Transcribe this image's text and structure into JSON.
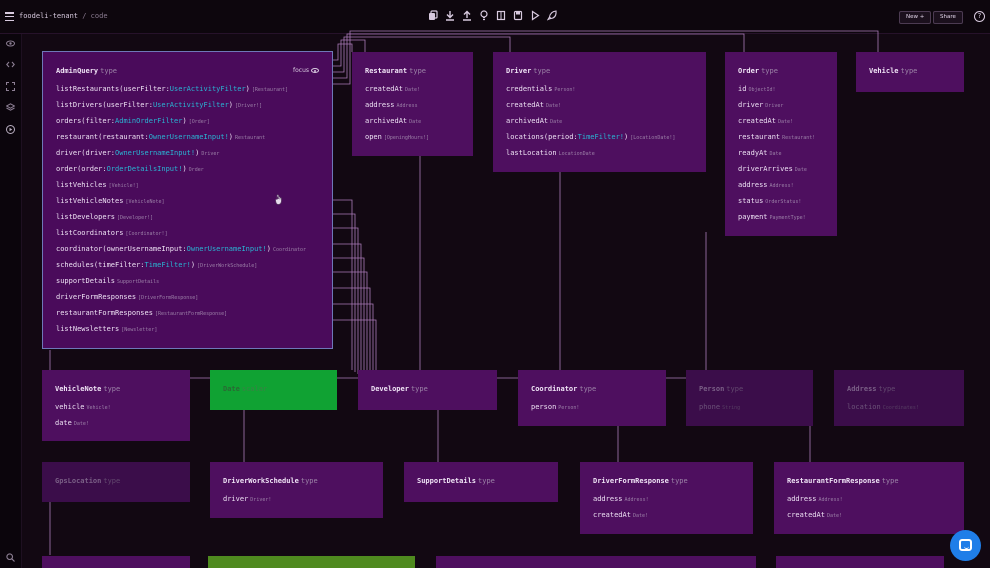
{
  "app": {
    "project": "foodeli-tenant",
    "separator": "/",
    "view": "code"
  },
  "toolbar": {
    "icons": [
      "copy-icon",
      "download-icon",
      "upload-icon",
      "lightbulb-icon",
      "book-icon",
      "save-icon",
      "play-icon",
      "rocket-icon"
    ],
    "new_label": "New +",
    "share_label": "Share",
    "help_label": "?"
  },
  "sidebar": {
    "icons": [
      "eye-icon",
      "code-icon",
      "expand-icon",
      "layers-icon",
      "play-circle-icon",
      "search-icon"
    ]
  },
  "colors": {
    "node_bg": "#4e0f5f",
    "focused_border": "#6e78b8",
    "arg_type": "#29b6d4",
    "green_node": "#10a233",
    "wire": "#c58fd6",
    "chat": "#1f7ee8"
  },
  "main_node": {
    "name": "AdminQuery",
    "kind": "type",
    "focus_label": "focus",
    "fields": [
      {
        "pre": "listRestaurants(",
        "arg": "userFilter:",
        "argType": "UserActivityFilter",
        "post": ")",
        "type": "[Restaurant]"
      },
      {
        "pre": "listDrivers(",
        "arg": "userFilter:",
        "argType": "UserActivityFilter",
        "post": ")",
        "type": "[Driver!]"
      },
      {
        "pre": "orders(",
        "arg": "filter:",
        "argType": "AdminOrderFilter",
        "post": ")",
        "type": "[Order]"
      },
      {
        "pre": "restaurant(",
        "arg": "restaurant:",
        "argType": "OwnerUsernameInput!",
        "post": ")",
        "type": "Restaurant"
      },
      {
        "pre": "driver(",
        "arg": "driver:",
        "argType": "OwnerUsernameInput!",
        "post": ")",
        "type": "Driver"
      },
      {
        "pre": "order(",
        "arg": "order:",
        "argType": "OrderDetailsInput!",
        "post": ")",
        "type": "Order"
      },
      {
        "pre": "listVehicles",
        "arg": "",
        "argType": "",
        "post": "",
        "type": "[Vehicle!]"
      },
      {
        "pre": "listVehicleNotes",
        "arg": "",
        "argType": "",
        "post": "",
        "type": "[VehicleNote]"
      },
      {
        "pre": "listDevelopers",
        "arg": "",
        "argType": "",
        "post": "",
        "type": "[Developer!]"
      },
      {
        "pre": "listCoordinators",
        "arg": "",
        "argType": "",
        "post": "",
        "type": "[Coordinator!]"
      },
      {
        "pre": "coordinator(",
        "arg": "ownerUsernameInput:",
        "argType": "OwnerUsernameInput!",
        "post": ")",
        "type": "Coordinator"
      },
      {
        "pre": "schedules(",
        "arg": "timeFilter:",
        "argType": "TimeFilter!",
        "post": ")",
        "type": "[DriverWorkSchedule]"
      },
      {
        "pre": "supportDetails",
        "arg": "",
        "argType": "",
        "post": "",
        "type": "SupportDetails"
      },
      {
        "pre": "driverFormResponses",
        "arg": "",
        "argType": "",
        "post": "",
        "type": "[DriverFormResponse]"
      },
      {
        "pre": "restaurantFormResponses",
        "arg": "",
        "argType": "",
        "post": "",
        "type": "[RestaurantFormResponse]"
      },
      {
        "pre": "listNewsletters",
        "arg": "",
        "argType": "",
        "post": "",
        "type": "[Newsletter]"
      }
    ]
  },
  "nodes": {
    "restaurant": {
      "name": "Restaurant",
      "kind": "type",
      "fields": [
        [
          "createdAt",
          "Date!"
        ],
        [
          "address",
          "Address"
        ],
        [
          "archivedAt",
          "Date"
        ],
        [
          "open",
          "[OpeningHours!]"
        ]
      ]
    },
    "driver": {
      "name": "Driver",
      "kind": "type",
      "fields": [
        [
          "credentials",
          "Person!"
        ],
        [
          "createdAt",
          "Date!"
        ],
        [
          "archivedAt",
          "Date"
        ],
        [
          "locations(period:TimeFilter!)",
          "[LocationDate!]"
        ],
        [
          "lastLocation",
          "LocationDate"
        ]
      ]
    },
    "order": {
      "name": "Order",
      "kind": "type",
      "fields": [
        [
          "id",
          "ObjectId!"
        ],
        [
          "driver",
          "Driver"
        ],
        [
          "createdAt",
          "Date!"
        ],
        [
          "restaurant",
          "Restaurant!"
        ],
        [
          "readyAt",
          "Date"
        ],
        [
          "driverArrives",
          "Date"
        ],
        [
          "address",
          "Address!"
        ],
        [
          "status",
          "OrderStatus!"
        ],
        [
          "payment",
          "PaymentType!"
        ]
      ]
    },
    "vehicle": {
      "name": "Vehicle",
      "kind": "type",
      "fields": []
    },
    "vehicleNote": {
      "name": "VehicleNote",
      "kind": "type",
      "fields": [
        [
          "vehicle",
          "Vehicle!"
        ],
        [
          "date",
          "Date!"
        ]
      ]
    },
    "date": {
      "name": "Date",
      "kind": "scalar",
      "fields": []
    },
    "developer": {
      "name": "Developer",
      "kind": "type",
      "fields": []
    },
    "coordinator": {
      "name": "Coordinator",
      "kind": "type",
      "fields": [
        [
          "person",
          "Person!"
        ]
      ]
    },
    "person": {
      "name": "Person",
      "kind": "type",
      "fields": [
        [
          "phone",
          "String"
        ]
      ]
    },
    "address": {
      "name": "Address",
      "kind": "type",
      "fields": [
        [
          "location",
          "Coordinates!"
        ]
      ]
    },
    "gpsLocation": {
      "name": "GpsLocation",
      "kind": "type",
      "fields": []
    },
    "driverWorkSchedule": {
      "name": "DriverWorkSchedule",
      "kind": "type",
      "fields": [
        [
          "driver",
          "Driver!"
        ]
      ]
    },
    "supportDetails": {
      "name": "SupportDetails",
      "kind": "type",
      "fields": []
    },
    "driverFormResponse": {
      "name": "DriverFormResponse",
      "kind": "type",
      "fields": [
        [
          "address",
          "Address!"
        ],
        [
          "createdAt",
          "Date!"
        ]
      ]
    },
    "restaurantFormResponse": {
      "name": "RestaurantFormResponse",
      "kind": "type",
      "fields": [
        [
          "address",
          "Address!"
        ],
        [
          "createdAt",
          "Date!"
        ]
      ]
    }
  }
}
